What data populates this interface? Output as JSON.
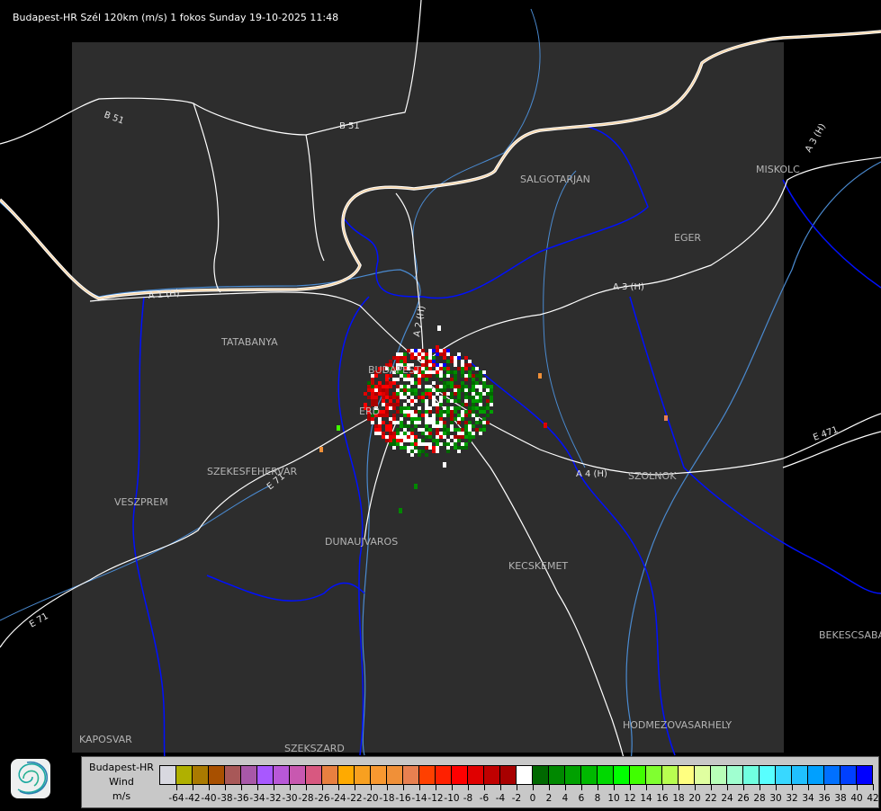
{
  "title": "Budapest-HR Szél 120km (m/s) 1 fokos Sunday 19-10-2025 11:48",
  "map": {
    "cities": [
      "SALGOTARJAN",
      "MISKOLC",
      "EGER",
      "TATABANYA",
      "BUDAPEST",
      "ERD",
      "SZEKESFEHERVAR",
      "VESZPREM",
      "DUNAUJVAROS",
      "KECSKEMET",
      "SZOLNOK",
      "BEKESCSABA",
      "HODMEZOVASARHELY",
      "KAPOSVAR",
      "SZEKSZARD"
    ],
    "roads": [
      "B 51",
      "B 51",
      "A 1 (H)",
      "A 2 (H)",
      "A 3 (H)",
      "A 3 (H)",
      "A 4 (H)",
      "E 71",
      "E 71",
      "E 471"
    ],
    "colors": {
      "background": "#000000",
      "radar_area": "#2d2d2d",
      "rivers": "#4a8ad0",
      "borders": "#0010ff",
      "roads": "#ffffff",
      "country_border": "#f5d3a5",
      "cities": "#b4b4b4"
    }
  },
  "legend": {
    "station": "Budapest-HR",
    "quantity": "Wind",
    "unit": "m/s",
    "colors": [
      "#d8d8e0",
      "#b0b000",
      "#aa7a00",
      "#a85000",
      "#a85858",
      "#a858a8",
      "#a858ff",
      "#b858d8",
      "#c858b0",
      "#d85880",
      "#e88040",
      "#ffaa00",
      "#f8a020",
      "#f89830",
      "#f09038",
      "#e88050",
      "#ff4000",
      "#ff2000",
      "#ff0000",
      "#e00000",
      "#c00000",
      "#a80000",
      "#ffffff",
      "#006800",
      "#008800",
      "#00a000",
      "#00b800",
      "#00d800",
      "#00ff00",
      "#40ff00",
      "#80ff30",
      "#b8ff50",
      "#ffff80",
      "#e0ffa0",
      "#b8ffb8",
      "#a0ffd0",
      "#70ffe0",
      "#58ffff",
      "#38d8ff",
      "#20c0ff",
      "#00a0ff",
      "#0070ff",
      "#0040ff",
      "#0000ff"
    ],
    "labels": [
      "-64",
      "-42",
      "-40",
      "-38",
      "-36",
      "-34",
      "-32",
      "-30",
      "-28",
      "-26",
      "-24",
      "-22",
      "-20",
      "-18",
      "-16",
      "-14",
      "-12",
      "-10",
      "-8",
      "-6",
      "-4",
      "-2",
      "0",
      "2",
      "4",
      "6",
      "8",
      "10",
      "12",
      "14",
      "16",
      "18",
      "20",
      "22",
      "24",
      "26",
      "28",
      "30",
      "32",
      "34",
      "36",
      "38",
      "40",
      "42"
    ]
  },
  "logo": "wave-swirl-logo"
}
